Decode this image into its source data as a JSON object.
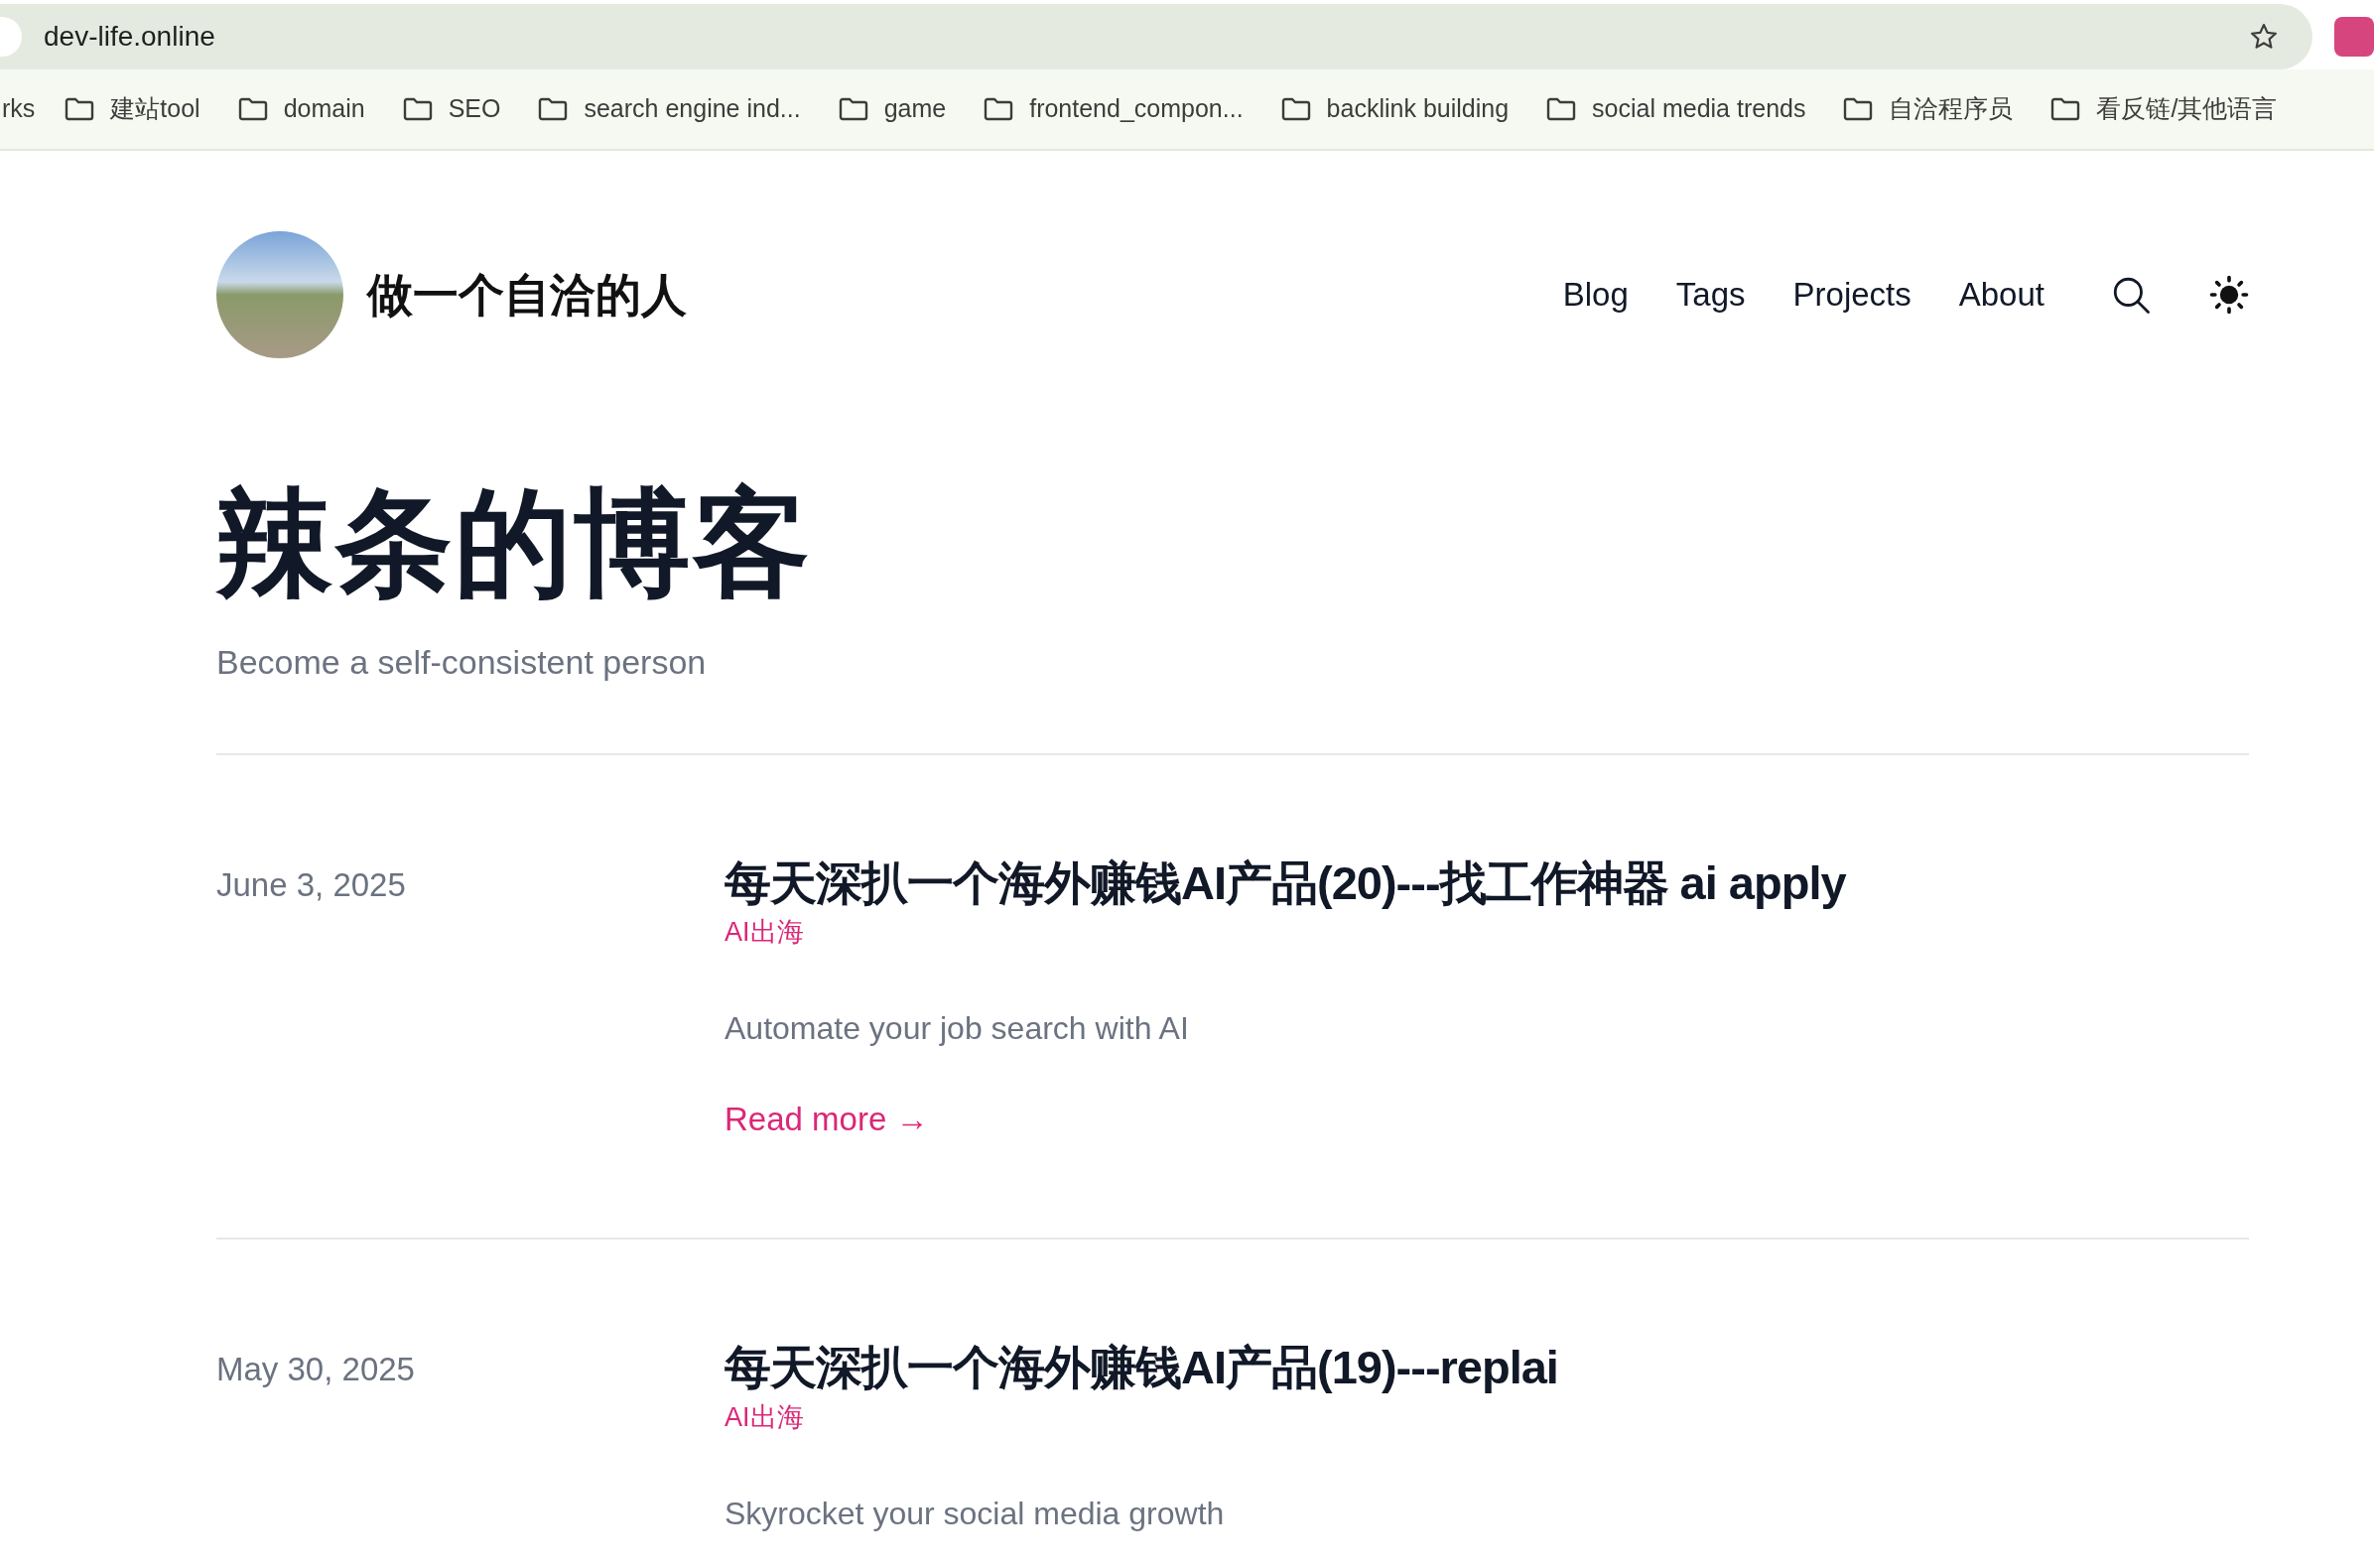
{
  "browser": {
    "url": "dev-life.online",
    "bookmarks": [
      {
        "label": "rks",
        "kind": "cut"
      },
      {
        "label": "建站tool",
        "kind": "folder"
      },
      {
        "label": "domain",
        "kind": "folder"
      },
      {
        "label": "SEO",
        "kind": "folder"
      },
      {
        "label": "search engine ind...",
        "kind": "folder"
      },
      {
        "label": "game",
        "kind": "folder"
      },
      {
        "label": "frontend_compon...",
        "kind": "folder"
      },
      {
        "label": "backlink building",
        "kind": "folder"
      },
      {
        "label": "social media trends",
        "kind": "folder"
      },
      {
        "label": "自洽程序员",
        "kind": "folder"
      },
      {
        "label": "看反链/其他语言",
        "kind": "folder"
      }
    ]
  },
  "site": {
    "title": "做一个自洽的人",
    "nav": [
      "Blog",
      "Tags",
      "Projects",
      "About"
    ]
  },
  "hero": {
    "title": "辣条的博客",
    "subtitle": "Become a self-consistent person"
  },
  "posts": [
    {
      "date": "June 3, 2025",
      "title": "每天深扒一个海外赚钱AI产品(20)---找工作神器 ai apply",
      "tag": "AI出海",
      "summary": "Automate your job search with AI",
      "read_more": "Read more →"
    },
    {
      "date": "May 30, 2025",
      "title": "每天深扒一个海外赚钱AI产品(19)---replai",
      "tag": "AI出海",
      "summary": "Skyrocket your social media growth"
    }
  ]
}
